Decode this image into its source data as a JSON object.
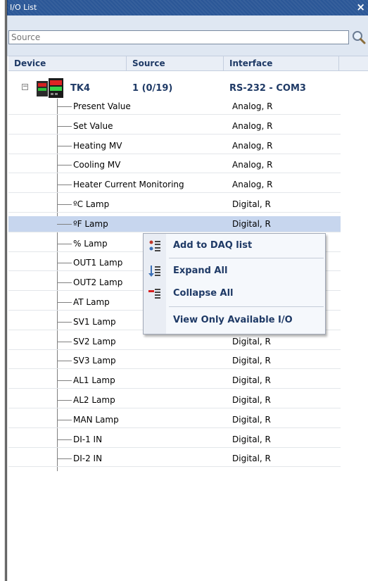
{
  "window": {
    "title": "I/O List",
    "close_glyph": "×"
  },
  "search": {
    "placeholder": "Source",
    "value": "",
    "icon": "search-icon"
  },
  "columns": {
    "device": "Device",
    "source": "Source",
    "interface": "Interface"
  },
  "device": {
    "expander": "−",
    "name": "TK4",
    "source": "1 (0/19)",
    "interface": "RS-232 - COM3"
  },
  "items": [
    {
      "name": "Present Value",
      "interface": "Analog, R"
    },
    {
      "name": "Set Value",
      "interface": "Analog, R"
    },
    {
      "name": "Heating MV",
      "interface": "Analog, R"
    },
    {
      "name": "Cooling MV",
      "interface": "Analog, R"
    },
    {
      "name": "Heater Current Monitoring",
      "interface": "Analog, R"
    },
    {
      "name": "ºC Lamp",
      "interface": "Digital, R"
    },
    {
      "name": "ºF Lamp",
      "interface": "Digital, R"
    },
    {
      "name": "% Lamp",
      "interface": ""
    },
    {
      "name": "OUT1 Lamp",
      "interface": ""
    },
    {
      "name": "OUT2 Lamp",
      "interface": ""
    },
    {
      "name": "AT Lamp",
      "interface": ""
    },
    {
      "name": "SV1 Lamp",
      "interface": ""
    },
    {
      "name": "SV2 Lamp",
      "interface": "Digital, R"
    },
    {
      "name": "SV3 Lamp",
      "interface": "Digital, R"
    },
    {
      "name": "AL1 Lamp",
      "interface": "Digital, R"
    },
    {
      "name": "AL2 Lamp",
      "interface": "Digital, R"
    },
    {
      "name": "MAN Lamp",
      "interface": "Digital, R"
    },
    {
      "name": "DI-1 IN",
      "interface": "Digital, R"
    },
    {
      "name": "DI-2 IN",
      "interface": "Digital, R"
    }
  ],
  "selected_index": 6,
  "context_menu": {
    "add": "Add to DAQ list",
    "expand": "Expand All",
    "collapse": "Collapse All",
    "view_only": "View Only Available I/O"
  },
  "colors": {
    "titlebar": "#2b5797",
    "selection": "#c7d6ee",
    "header_text": "#1f3a66"
  }
}
